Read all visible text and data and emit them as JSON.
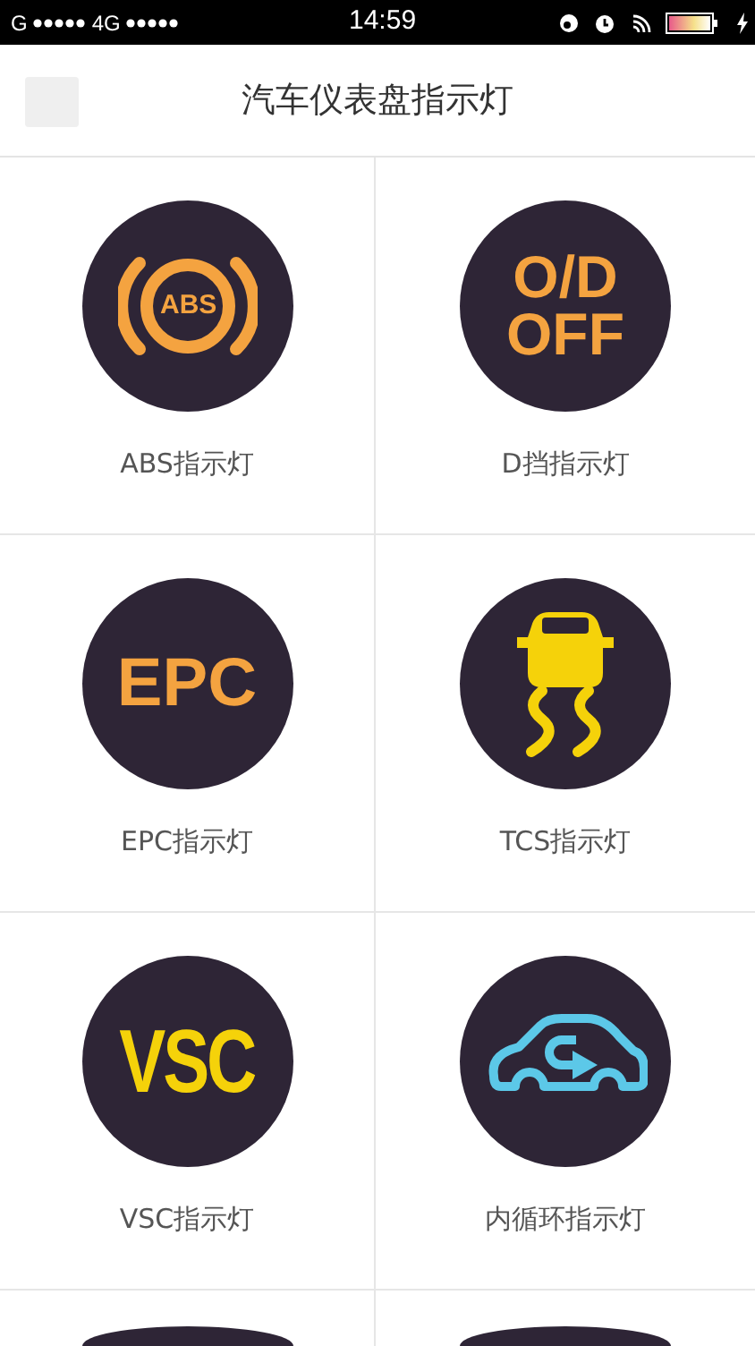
{
  "status_bar": {
    "carrier_1": "G",
    "carrier_2": "4G",
    "time": "14:59"
  },
  "header": {
    "title": "汽车仪表盘指示灯"
  },
  "items": [
    {
      "kind": "abs",
      "symbol": [
        "ABS"
      ],
      "color": "#f4a340",
      "label": "ABS指示灯"
    },
    {
      "kind": "text",
      "symbol": [
        "O/D",
        "OFF"
      ],
      "color": "#f4a340",
      "label": "D挡指示灯"
    },
    {
      "kind": "text",
      "symbol": [
        "EPC"
      ],
      "color": "#f4a340",
      "label": "EPC指示灯"
    },
    {
      "kind": "skid",
      "color": "#f5d20a",
      "label": "TCS指示灯"
    },
    {
      "kind": "narrow",
      "symbol": [
        "VSC"
      ],
      "color": "#f5d20a",
      "label": "VSC指示灯"
    },
    {
      "kind": "recirc",
      "color": "#5cc8e8",
      "label": "内循环指示灯"
    },
    {
      "kind": "cut"
    },
    {
      "kind": "cut"
    }
  ]
}
